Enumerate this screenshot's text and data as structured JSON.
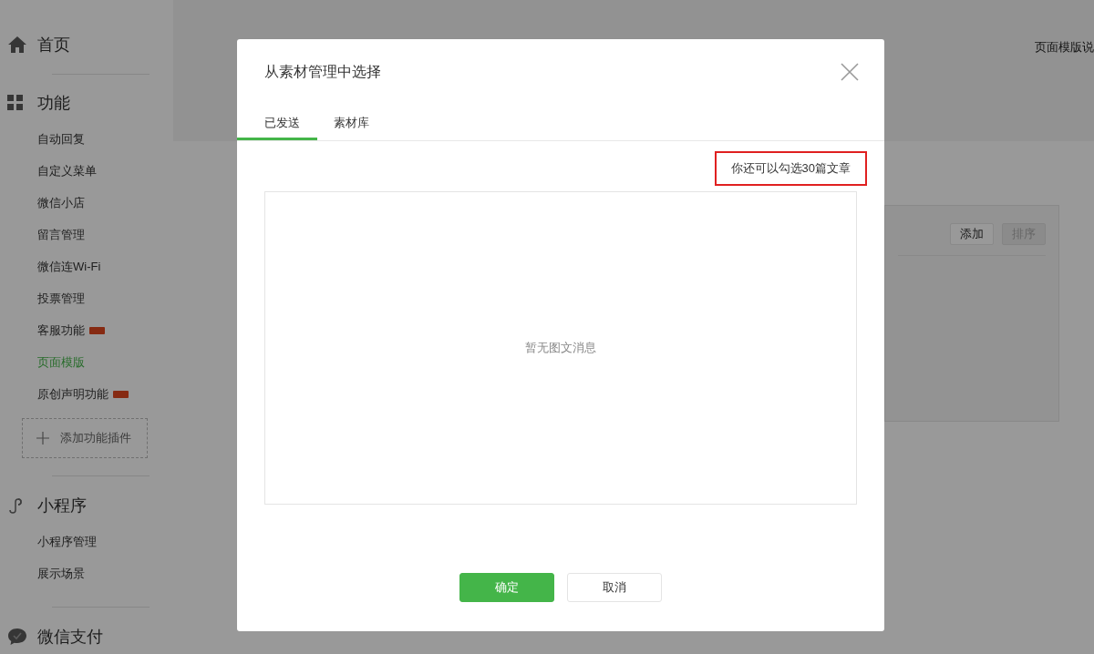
{
  "sidebar": {
    "sections": [
      {
        "kind": "home",
        "title": "首页"
      },
      {
        "kind": "grid",
        "title": "功能",
        "items": [
          {
            "label": "自动回复",
            "selected": false,
            "new": false
          },
          {
            "label": "自定义菜单",
            "selected": false,
            "new": false
          },
          {
            "label": "微信小店",
            "selected": false,
            "new": false
          },
          {
            "label": "留言管理",
            "selected": false,
            "new": false
          },
          {
            "label": "微信连Wi-Fi",
            "selected": false,
            "new": false
          },
          {
            "label": "投票管理",
            "selected": false,
            "new": false
          },
          {
            "label": "客服功能",
            "selected": false,
            "new": true
          },
          {
            "label": "页面模版",
            "selected": true,
            "new": false
          },
          {
            "label": "原创声明功能",
            "selected": false,
            "new": true
          }
        ],
        "add_button": "添加功能插件"
      },
      {
        "kind": "link",
        "title": "小程序",
        "items": [
          {
            "label": "小程序管理",
            "selected": false,
            "new": false
          },
          {
            "label": "展示场景",
            "selected": false,
            "new": false
          }
        ]
      },
      {
        "kind": "chat",
        "title": "微信支付"
      }
    ]
  },
  "page": {
    "help_link": "页面模版说",
    "buttons": [
      {
        "label": "添加",
        "disabled": false
      },
      {
        "label": "排序",
        "disabled": true
      }
    ]
  },
  "dialog": {
    "title": "从素材管理中选择",
    "tabs": [
      {
        "label": "已发送",
        "selected": true
      },
      {
        "label": "素材库",
        "selected": false
      }
    ],
    "notice": "你还可以勾选30篇文章",
    "empty_text": "暂无图文消息",
    "buttons": [
      {
        "label": "确定",
        "kind": "primary"
      },
      {
        "label": "取消",
        "kind": "default"
      }
    ]
  }
}
